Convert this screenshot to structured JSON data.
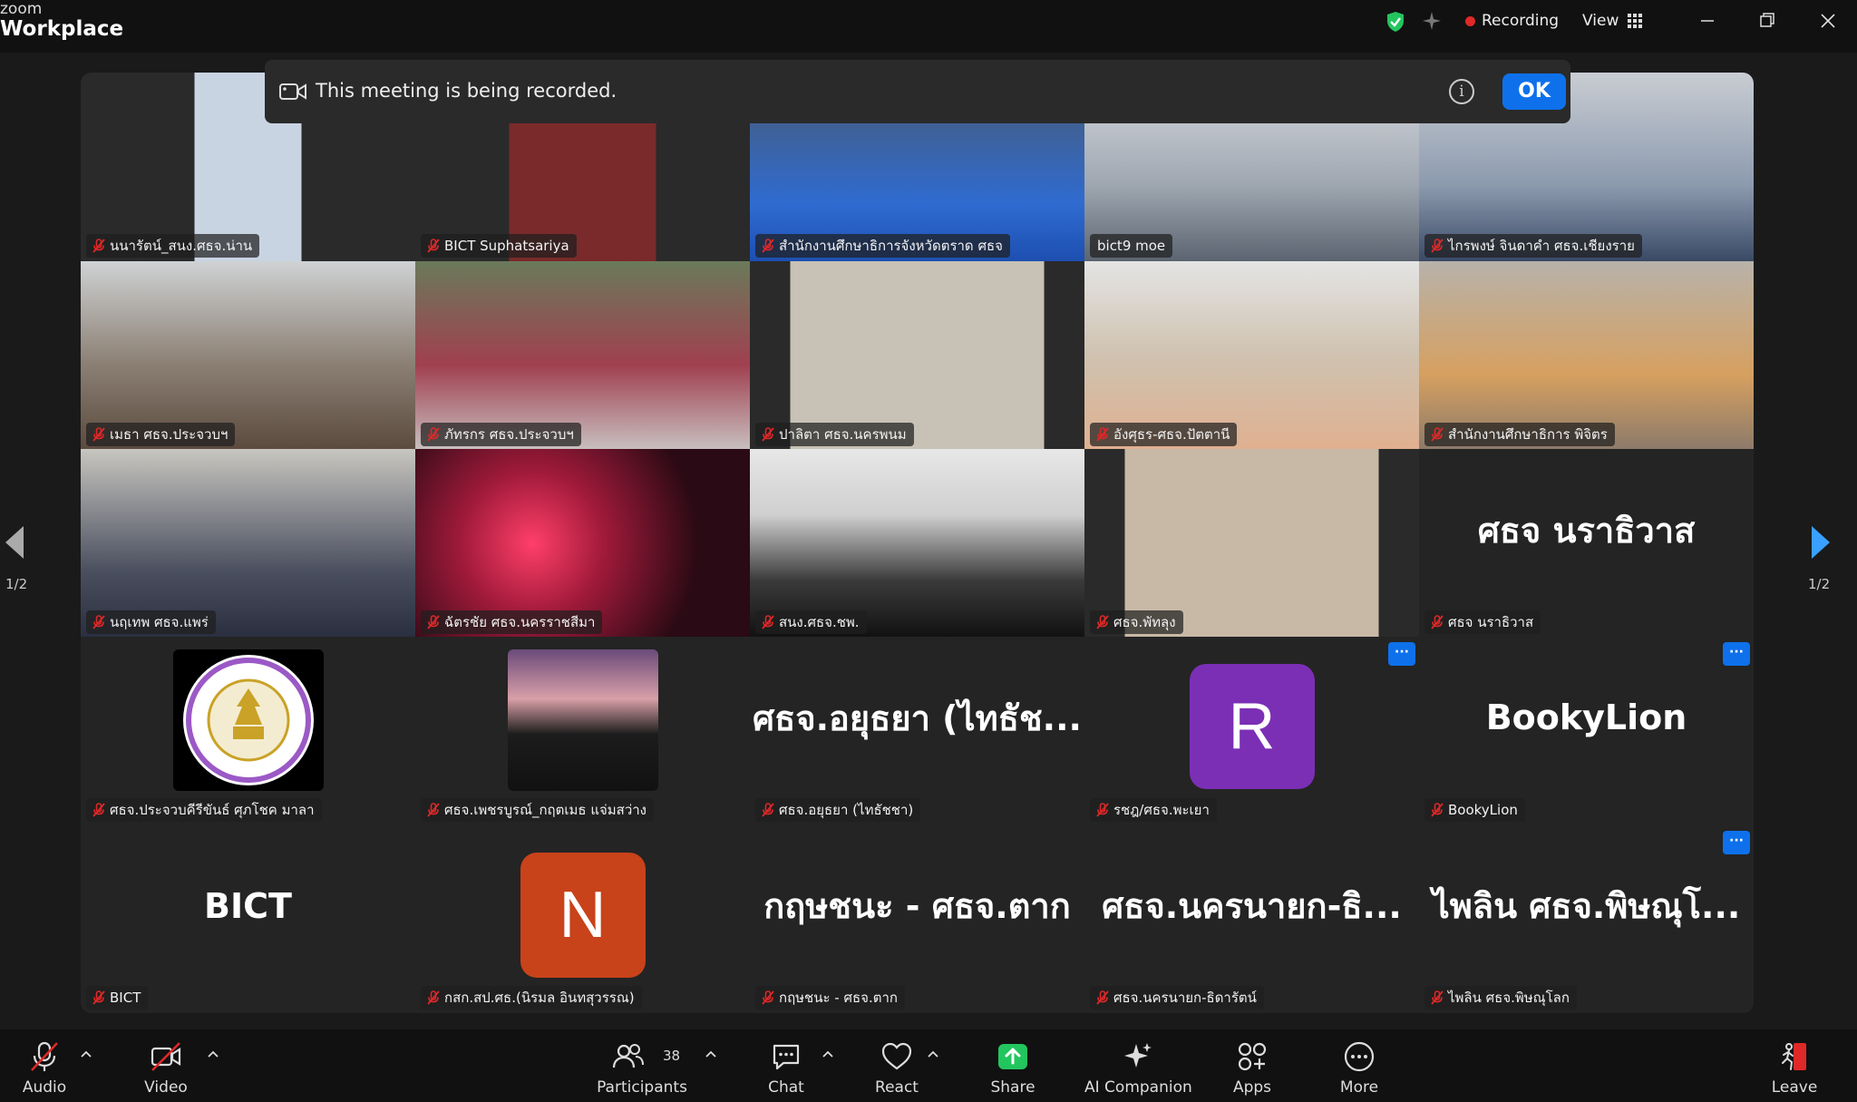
{
  "app": {
    "brand_top": "zoom",
    "brand_bottom": "Workplace"
  },
  "titlebar": {
    "recording_label": "Recording",
    "view_label": "View"
  },
  "banner": {
    "message": "This meeting is being recorded.",
    "ok_label": "OK",
    "info_glyph": "i"
  },
  "pagination": {
    "left": "1/2",
    "right": "1/2"
  },
  "tiles": [
    {
      "name": "นนารัตน์_สนง.ศธจ.น่าน",
      "kind": "video"
    },
    {
      "name": "BICT Suphatsariya",
      "kind": "video"
    },
    {
      "name": "สำนักงานศึกษาธิการจังหวัดตราด ศธจ",
      "kind": "video"
    },
    {
      "name": "bict9 moe",
      "kind": "video",
      "active": true,
      "muted": false
    },
    {
      "name": "ไกรพงษ์ จินดาคำ ศธจ.เชียงราย",
      "kind": "video"
    },
    {
      "name": "เมธา ศธจ.ประจวบฯ",
      "kind": "video"
    },
    {
      "name": "ภัทรกร ศธจ.ประจวบฯ",
      "kind": "video"
    },
    {
      "name": "ปาลิตา ศธจ.นครพนม",
      "kind": "video"
    },
    {
      "name": "อังศุธร-ศธจ.ปัตตานี",
      "kind": "video"
    },
    {
      "name": "สำนักงานศึกษาธิการ พิจิตร",
      "kind": "video"
    },
    {
      "name": "นฤเทพ ศธจ.แพร่",
      "kind": "video"
    },
    {
      "name": "ฉัตรชัย ศธจ.นครราชสีมา",
      "kind": "video"
    },
    {
      "name": "สนง.ศธจ.ชพ.",
      "kind": "video"
    },
    {
      "name": "ศธจ.พัทลุง",
      "kind": "video"
    },
    {
      "name": "ศธจ นราธิวาส",
      "kind": "text",
      "big": "ศธจ นราธิวาส"
    },
    {
      "name": "ศธจ.ประจวบคีรีขันธ์ ศุภโชค มาลา",
      "kind": "logo"
    },
    {
      "name": "ศธจ.เพชรบูรณ์_กฤตเมธ แจ่มสว่าง",
      "kind": "photo"
    },
    {
      "name": "ศธจ.อยุธยา (ไทธัชชา)",
      "kind": "text",
      "big": "ศธจ.อยุธยา (ไทธัช..."
    },
    {
      "name": "รชฎ/ศธจ.พะเยา",
      "kind": "avatar",
      "initial": "R",
      "more": "···"
    },
    {
      "name": "BookyLion",
      "kind": "text",
      "big": "BookyLion",
      "more": "···"
    },
    {
      "name": "BICT",
      "kind": "text",
      "big": "BICT"
    },
    {
      "name": "กสก.สป.ศธ.(นิรมล อินทสุวรรณ)",
      "kind": "avatar",
      "initial": "N"
    },
    {
      "name": "กฤษชนะ - ศธจ.ตาก",
      "kind": "text",
      "big": "กฤษชนะ - ศธจ.ตาก"
    },
    {
      "name": "ศธจ.นครนายก-ธิดารัตน์",
      "kind": "text",
      "big": "ศธจ.นครนายก-ธิ..."
    },
    {
      "name": "ไพลิน ศธจ.พิษณุโลก",
      "kind": "text",
      "big": "ไพลิน ศธจ.พิษณุโ...",
      "more": "···"
    }
  ],
  "toolbar": {
    "audio": "Audio",
    "video": "Video",
    "participants": "Participants",
    "participants_count": "38",
    "chat": "Chat",
    "react": "React",
    "share": "Share",
    "ai_companion": "AI Companion",
    "apps": "Apps",
    "more": "More",
    "leave": "Leave"
  },
  "colors": {
    "accent_blue": "#0e71eb",
    "share_green": "#23c55e",
    "avatar_r": "#7b2fb5",
    "avatar_n": "#c8421a",
    "active_speaker": "#23d18b",
    "record_red": "#e02828"
  }
}
